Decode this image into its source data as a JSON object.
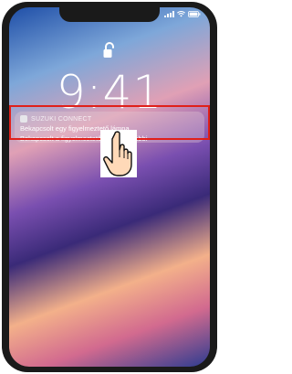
{
  "status_bar": {
    "signal_icon": "cellular-signal-icon",
    "wifi_icon": "wifi-icon",
    "battery_icon": "battery-icon"
  },
  "lock_screen": {
    "lock_icon": "unlocked-padlock-icon",
    "time": "9:41"
  },
  "notification": {
    "app_name": "SUZUKI CONNECT",
    "line_1": "Bekapcsolt egy figyelmeztető lámpa",
    "line_2": "Bekapcsolt a figyelmeztető lámpa További"
  },
  "annotation": {
    "highlight_color": "#e0201a",
    "pointer_icon": "tapping-hand-icon"
  }
}
